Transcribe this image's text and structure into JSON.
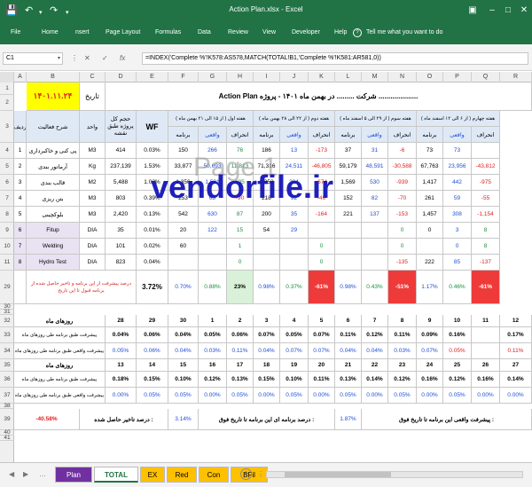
{
  "window": {
    "title": "Action Plan.xlsx - Excel"
  },
  "menu": [
    "File",
    "Home",
    "nsert",
    "Page Layout",
    "Formulas",
    "Data",
    "Review",
    "View",
    "Developer",
    "Help"
  ],
  "tellme": "Tell me what you want to do",
  "formula_bar": {
    "name_box": "C1",
    "formula": "=INDEX('Complete %'!K578:AS578,MATCH(TOTAL!B1,'Complete %'!K581:AR581,0))"
  },
  "columns": [
    "A",
    "B",
    "C",
    "D",
    "E",
    "F",
    "G",
    "H",
    "I",
    "J",
    "K",
    "L",
    "M",
    "N",
    "O",
    "P",
    "Q",
    "R"
  ],
  "rows": [
    "1",
    "2",
    "3",
    "4",
    "5",
    "6",
    "7",
    "8",
    "9",
    "10",
    "11",
    "12",
    "13",
    "14",
    "15",
    "16",
    "17",
    "18",
    "19",
    "20",
    "21",
    "22",
    "23",
    "24",
    "29",
    "30",
    "31",
    "32",
    "33",
    "34",
    "35",
    "36",
    "37",
    "38",
    "39",
    "40",
    "41",
    "42"
  ],
  "header": {
    "date_value": "۱۴۰۱.۱۱.۲۴",
    "date_label": "تاریخ",
    "title": "Action Plan شرکت ......... در بهمن ماه ۱۴۰۱ - پروژه ....................",
    "wf": "WF",
    "unit": "واحد",
    "qty": "حجم کل پروژه طبق نقشه",
    "activity": "شرح فعالیت",
    "row_label": "ردیف",
    "weeks": [
      "هفته اول ( از ۱۵ الی ۲۱ بهمن ماه )",
      "هفته دوم ( از ۲۲ الی ۲۸ بهمن ماه )",
      "هفته سوم ( از ۲۹ الی ۵ اسفند ماه )",
      "هفته چهارم ( از ۶ الی ۱۲ اسفند ماه )"
    ],
    "week_sub": [
      "برنامه",
      "واقعی",
      "انحراف"
    ]
  },
  "activities": [
    {
      "n": "1",
      "name": "پی کنی و خاکبرداری",
      "unit": "M3",
      "qty": "414",
      "wf": "0.03%",
      "w": [
        [
          "150",
          "266",
          "76"
        ],
        [
          "186",
          "13",
          "-173"
        ],
        [
          "37",
          "31",
          "-6"
        ],
        [
          "73",
          "73",
          ""
        ]
      ]
    },
    {
      "n": "2",
      "name": "آرماتور بندی",
      "unit": "Kg",
      "qty": "237,139",
      "wf": "1.53%",
      "w": [
        [
          "33,877",
          "50,693",
          "11,813"
        ],
        [
          "71,316",
          "24,511",
          "-46,805"
        ],
        [
          "59,179",
          "48,591",
          "-30,588"
        ],
        [
          "67,763",
          "23,956",
          "-43,812"
        ]
      ]
    },
    {
      "n": "3",
      "name": "قالب بندی",
      "unit": "M2",
      "qty": "5,488",
      "wf": "1.03%",
      "w": [
        [
          "1,356",
          "1,521",
          "195"
        ],
        [
          "1,253",
          "384",
          "-674"
        ],
        [
          "1,569",
          "530",
          "-939"
        ],
        [
          "1,417",
          "442",
          "-975"
        ]
      ]
    },
    {
      "n": "4",
      "name": "بتن ریزی",
      "unit": "M3",
      "qty": "803",
      "wf": "0.39%",
      "w": [
        [
          "253",
          "63",
          "-90"
        ],
        [
          "218",
          "92",
          "-46"
        ],
        [
          "152",
          "82",
          "-70"
        ],
        [
          "261",
          "59",
          "-55"
        ]
      ]
    },
    {
      "n": "5",
      "name": "بلوکچینی",
      "unit": "M3",
      "qty": "2,420",
      "wf": "0.13%",
      "w": [
        [
          "542",
          "630",
          "87"
        ],
        [
          "200",
          "35",
          "-164"
        ],
        [
          "221",
          "137",
          "-153"
        ],
        [
          "1,457",
          "308",
          "-1,154"
        ]
      ]
    },
    {
      "n": "6",
      "name": "Fitup",
      "unit": "DIA",
      "qty": "35",
      "wf": "0.01%",
      "w": [
        [
          "20",
          "122",
          "15"
        ],
        [
          "54",
          "29",
          "",
          "13"
        ],
        [
          "",
          "",
          "0"
        ],
        [
          "0",
          "3",
          "8"
        ]
      ]
    },
    {
      "n": "7",
      "name": "Welding",
      "unit": "DIA",
      "qty": "101",
      "wf": "0.02%",
      "w": [
        [
          "60",
          "",
          "1"
        ],
        [
          "",
          "",
          "0"
        ],
        [
          "",
          "",
          "0"
        ],
        [
          "",
          "0",
          "8"
        ]
      ]
    },
    {
      "n": "8",
      "name": "Hydro Test",
      "unit": "DIA",
      "qty": "823",
      "wf": "0.04%",
      "w": [
        [
          "",
          "",
          "0"
        ],
        [
          "",
          "",
          "0"
        ],
        [
          "",
          "",
          "-135"
        ],
        [
          "222",
          "85",
          "-137"
        ]
      ]
    }
  ],
  "progress_row": {
    "note": "درصد پیشرفت از این برنامه و تاخیر حاصل شده از برنامه قبول تا این تاریخ",
    "total_wf": "3.72%",
    "cells": [
      "0.70%",
      "0.88%",
      "23%",
      "0.98%",
      "0.37%",
      "-61%",
      "0.98%",
      "0.43%",
      "-51%",
      "1.17%",
      "0.46%",
      "-61%"
    ]
  },
  "days_row_a": {
    "label": "روزهای ماه",
    "days": [
      "28",
      "29",
      "30",
      "1",
      "2",
      "3",
      "4",
      "5",
      "6",
      "7",
      "8",
      "9",
      "10",
      "11",
      "12"
    ]
  },
  "plan_row_a": {
    "label": "پیشرفت طبق برنامه طی روزهای ماه",
    "values": [
      "0.04%",
      "0.06%",
      "0.04%",
      "0.05%",
      "0.06%",
      "0.07%",
      "0.05%",
      "0.07%",
      "0.11%",
      "0.12%",
      "0.11%",
      "0.09%",
      "0.16%",
      "",
      "0.17%"
    ]
  },
  "actual_row_a": {
    "label": "پیشرفت واقعی طبق برنامه طی روزهای ماه",
    "values": [
      "0.05%",
      "0.06%",
      "0.04%",
      "0.03%",
      "0.11%",
      "0.04%",
      "0.07%",
      "0.07%",
      "0.04%",
      "0.04%",
      "0.03%",
      "0.07%",
      "0.05%",
      "",
      "0.11%"
    ]
  },
  "days_row_b": {
    "label": "روزهای ماه",
    "days": [
      "13",
      "14",
      "15",
      "16",
      "17",
      "18",
      "19",
      "20",
      "21",
      "22",
      "23",
      "24",
      "25",
      "26",
      "27"
    ]
  },
  "plan_row_b": {
    "label": "پیشرفت طبق برنامه طی روزهای ماه",
    "values": [
      "0.18%",
      "0.15%",
      "0.10%",
      "0.12%",
      "0.13%",
      "0.15%",
      "0.10%",
      "0.11%",
      "0.13%",
      "0.14%",
      "0.12%",
      "0.16%",
      "0.12%",
      "0.16%",
      "0.14%"
    ]
  },
  "actual_row_b": {
    "label": "پیشرفت واقعی طبق برنامه طی روزهای ماه",
    "values": [
      "0.00%",
      "0.05%",
      "0.05%",
      "0.00%",
      "0.05%",
      "0.00%",
      "0.05%",
      "0.00%",
      "0.05%",
      "0.00%",
      "0.05%",
      "0.00%",
      "0.05%",
      "0.00%",
      "0.00%"
    ]
  },
  "summary": {
    "delay_value": "-40.58%",
    "delay_label": "درصد تاخیر حاصل شده :",
    "plan_value": "3.14%",
    "plan_label": "درصد برنامه ای این برنامه تا تاریخ فوق :",
    "actual_value": "1.87%",
    "actual_label": "پیشرفت واقعی این برنامه تا تاریخ فوق :"
  },
  "watermark": "vendorfile.ir",
  "pagemark": "Page 1",
  "sheet_tabs": [
    {
      "label": "Plan",
      "color": "#7030a0",
      "text": "#ffffff"
    },
    {
      "label": "TOTAL",
      "color": "#ffffff",
      "text": "#217346"
    },
    {
      "label": "EX",
      "color": "#ffc000",
      "text": "#000000"
    },
    {
      "label": "Red",
      "color": "#ffc000",
      "text": "#000000"
    },
    {
      "label": "Con",
      "color": "#ffc000",
      "text": "#000000"
    },
    {
      "label": "BFil",
      "color": "#ffc000",
      "text": "#000000"
    }
  ]
}
